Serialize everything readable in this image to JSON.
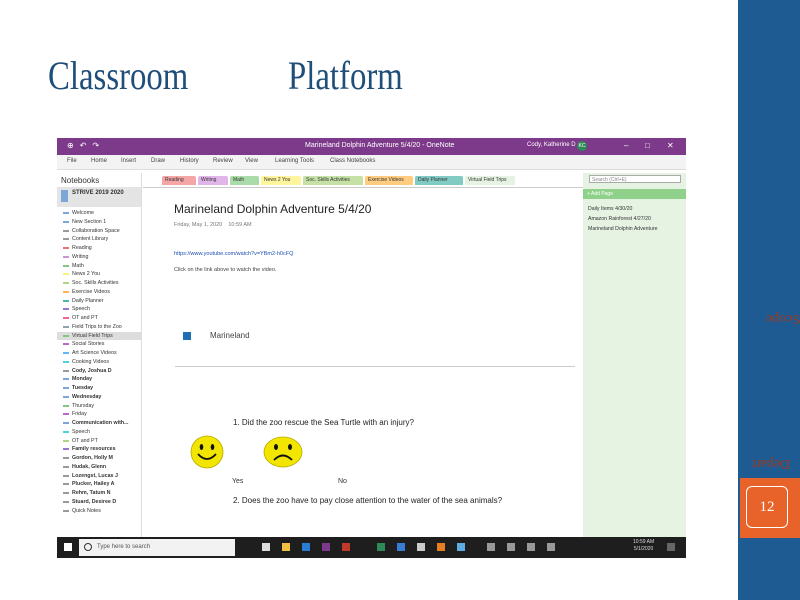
{
  "slide": {
    "title_left": "Classroom",
    "title_right": "Platform",
    "sidebar_rotated_1": "Scope",
    "sidebar_rotated_2": "Depart",
    "page_number": "12"
  },
  "app": {
    "window_title": "Marineland Dolphin Adventure 5/4/20 - OneNote",
    "user": "Cody, Katherine D",
    "user_initials": "KC",
    "menu": [
      "File",
      "Home",
      "Insert",
      "Draw",
      "History",
      "Review",
      "View",
      "Learning Tools",
      "Class Notebooks"
    ],
    "notebooks_header": "Notebooks",
    "notebook_name": "STRIVE 2019 2020",
    "sections": [
      {
        "label": "Welcome",
        "color": "#7aa7d8",
        "bold": false
      },
      {
        "label": "New Section 1",
        "color": "#7aa7d8",
        "bold": false
      },
      {
        "label": "Collaboration Space",
        "color": "#9a9a9a",
        "bold": false
      },
      {
        "label": "Content Library",
        "color": "#9a9a9a",
        "bold": false
      },
      {
        "label": "Reading",
        "color": "#e57373",
        "bold": false
      },
      {
        "label": "Writing",
        "color": "#ce93d8",
        "bold": false
      },
      {
        "label": "Math",
        "color": "#81c784",
        "bold": false
      },
      {
        "label": "News 2 You",
        "color": "#fff176",
        "bold": false
      },
      {
        "label": "Soc. Skills Activities",
        "color": "#aed581",
        "bold": false
      },
      {
        "label": "Exercise Videos",
        "color": "#ffb74d",
        "bold": false
      },
      {
        "label": "Daily Planner",
        "color": "#4db6ac",
        "bold": false
      },
      {
        "label": "Speech",
        "color": "#9575cd",
        "bold": false
      },
      {
        "label": "OT and PT",
        "color": "#f06292",
        "bold": false
      },
      {
        "label": "Field Trips to the Zoo",
        "color": "#90a4ae",
        "bold": false
      },
      {
        "label": "Virtual Field Trips",
        "color": "#81c784",
        "bold": false
      },
      {
        "label": "Social Stories",
        "color": "#ba68c8",
        "bold": false
      },
      {
        "label": "Art Science Videos",
        "color": "#64b5f6",
        "bold": false
      },
      {
        "label": "Cooking Videos",
        "color": "#4dd0e1",
        "bold": false
      },
      {
        "label": "Cody, Joshua D",
        "color": "#9a9a9a",
        "bold": true
      },
      {
        "label": "Monday",
        "color": "#7aa7d8",
        "bold": true
      },
      {
        "label": "Tuesday",
        "color": "#7aa7d8",
        "bold": true
      },
      {
        "label": "Wednesday",
        "color": "#7aa7d8",
        "bold": true
      },
      {
        "label": "Thursday",
        "color": "#81c784",
        "bold": false
      },
      {
        "label": "Friday",
        "color": "#ba68c8",
        "bold": false
      },
      {
        "label": "Communication with...",
        "color": "#7aa7d8",
        "bold": true
      },
      {
        "label": "Speech",
        "color": "#4dd0e1",
        "bold": false
      },
      {
        "label": "OT and PT",
        "color": "#aed581",
        "bold": false
      },
      {
        "label": "Family resources",
        "color": "#9575cd",
        "bold": true
      },
      {
        "label": "Gordon, Holly M",
        "color": "#9a9a9a",
        "bold": true
      },
      {
        "label": "Hudak, Glenn",
        "color": "#9a9a9a",
        "bold": true
      },
      {
        "label": "Lozengst, Lucas J",
        "color": "#9a9a9a",
        "bold": true
      },
      {
        "label": "Plucker, Hailey A",
        "color": "#9a9a9a",
        "bold": true
      },
      {
        "label": "Rehm, Tatum N",
        "color": "#9a9a9a",
        "bold": true
      },
      {
        "label": "Stuard, Desiree D",
        "color": "#9a9a9a",
        "bold": true
      },
      {
        "label": "Quick Notes",
        "color": "#9a9a9a",
        "bold": false
      }
    ],
    "tabs": [
      {
        "label": "Reading",
        "color": "#f4a6a6"
      },
      {
        "label": "Writing",
        "color": "#e1b5ea"
      },
      {
        "label": "Math",
        "color": "#a9dca9"
      },
      {
        "label": "News 2 You",
        "color": "#fff59d"
      },
      {
        "label": "Soc. Skills Activities",
        "color": "#c5e1a5"
      },
      {
        "label": "Exercise Videos",
        "color": "#ffcc80"
      },
      {
        "label": "Daily Planner",
        "color": "#80cbc4"
      },
      {
        "label": "Virtual Field Trips",
        "color": "#e6f3e3"
      }
    ],
    "page": {
      "title": "Marineland Dolphin Adventure 5/4/20",
      "date": "Friday, May 1, 2020",
      "time": "10:59 AM",
      "link": "https://www.youtube.com/watch?v=YBm2-h0cFQ",
      "instruction": "Click on the link above to watch the video.",
      "attachment": "Marineland",
      "question1": "1.  Did the zoo rescue the Sea Turtle with an injury?",
      "yes": "Yes",
      "no": "No",
      "question2": "2.  Does the zoo have to pay close attention to the water of the sea animals?"
    },
    "search_placeholder": "Search (Ctrl+E)",
    "add_page": "+ Add Page",
    "pages_list": [
      "Daily Items 4/30/20",
      "Amazon Rainforest 4/27/20",
      "Marineland Dolphin Adventure"
    ],
    "taskbar": {
      "search_placeholder": "Type here to search",
      "time": "10:59 AM",
      "date": "5/1/2020"
    }
  }
}
